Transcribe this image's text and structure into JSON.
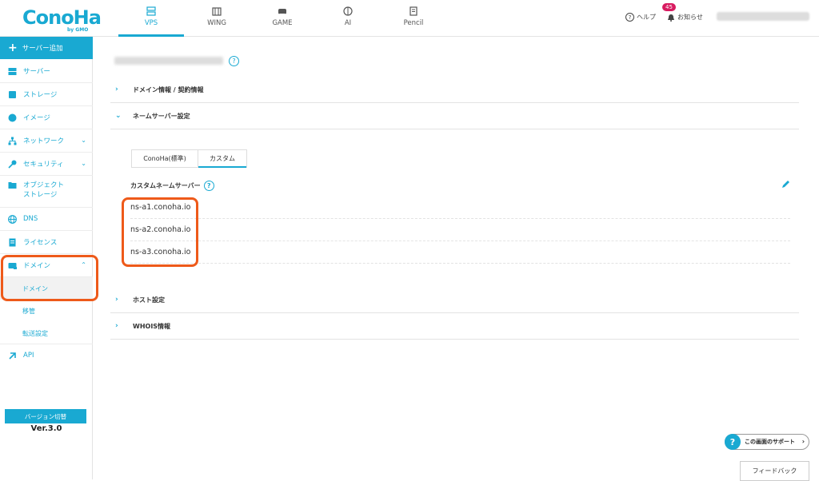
{
  "header": {
    "logo": "ConoHa",
    "logo_sub": "by GMO",
    "tabs": [
      {
        "label": "VPS",
        "icon": "server-icon",
        "active": true
      },
      {
        "label": "WING",
        "icon": "building-icon",
        "active": false
      },
      {
        "label": "GAME",
        "icon": "gamepad-icon",
        "active": false
      },
      {
        "label": "AI",
        "icon": "brain-icon",
        "active": false
      },
      {
        "label": "Pencil",
        "icon": "pencil-doc-icon",
        "active": false
      }
    ],
    "help_label": "ヘルプ",
    "notice_label": "お知らせ",
    "notice_count": "45"
  },
  "sidebar": {
    "add_label": "サーバー追加",
    "items": [
      {
        "label": "サーバー",
        "icon": "server-icon"
      },
      {
        "label": "ストレージ",
        "icon": "storage-icon"
      },
      {
        "label": "イメージ",
        "icon": "image-globe-icon"
      },
      {
        "label": "ネットワーク",
        "icon": "network-icon"
      },
      {
        "label": "セキュリティ",
        "icon": "key-icon"
      },
      {
        "label": "オブジェクト\nストレージ",
        "icon": "folder-icon"
      },
      {
        "label": "DNS",
        "icon": "globe-icon"
      },
      {
        "label": "ライセンス",
        "icon": "license-icon"
      },
      {
        "label": "ドメイン",
        "icon": "domain-icon"
      }
    ],
    "subitems": [
      {
        "label": "ドメイン",
        "active": true
      },
      {
        "label": "移管",
        "active": false
      },
      {
        "label": "転送設定",
        "active": false
      }
    ],
    "api_label": "API",
    "version_button": "バージョン切替",
    "version_label": "Ver.3.0"
  },
  "main": {
    "sections": [
      {
        "label": "ドメイン情報 / 契約情報",
        "expanded": false
      },
      {
        "label": "ネームサーバー設定",
        "expanded": true
      },
      {
        "label": "ホスト設定",
        "expanded": false
      },
      {
        "label": "WHOIS情報",
        "expanded": false
      }
    ],
    "tabs": [
      {
        "label": "ConoHa(標準)",
        "active": false
      },
      {
        "label": "カスタム",
        "active": true
      }
    ],
    "ns_heading": "カスタムネームサーバー",
    "nameservers": [
      "ns-a1.conoha.io",
      "ns-a2.conoha.io",
      "ns-a3.conoha.io"
    ]
  },
  "footer": {
    "support_label": "この画面のサポート",
    "feedback_label": "フィードバック"
  },
  "colors": {
    "accent": "#19a9d2",
    "highlight": "#ee5a1a",
    "badge": "#d81b60"
  }
}
